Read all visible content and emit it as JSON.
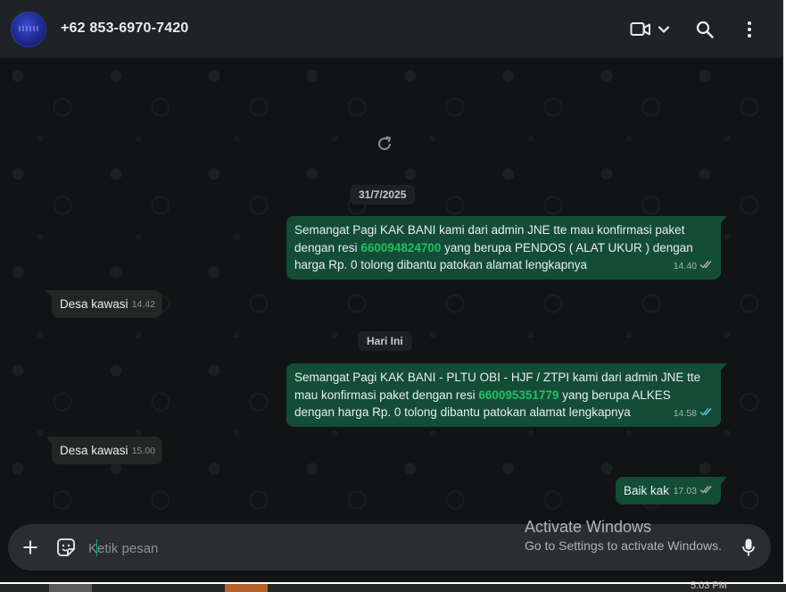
{
  "header": {
    "contact_name": "+62 853-6970-7420",
    "icons": [
      "video-call-icon",
      "chevron-down-icon",
      "search-icon",
      "menu-dots-icon"
    ]
  },
  "chat": {
    "date_chips": [
      "31/7/2025",
      "Hari Ini"
    ],
    "messages": [
      {
        "direction": "outgoing",
        "line1": "Semangat Pagi KAK BANI kami dari admin JNE tte mau konfirmasi paket",
        "line2_before": "dengan resi ",
        "resi": "660094824700",
        "line2_after": " yang berupa PENDOS ( ALAT UKUR ) dengan",
        "line3": "harga Rp. 0 tolong dibantu patokan alamat lengkapnya",
        "time": "14.40",
        "status": "delivered"
      },
      {
        "direction": "incoming",
        "text": "Desa kawasi",
        "time": "14.42"
      },
      {
        "direction": "outgoing",
        "line1": "Semangat Pagi KAK BANI - PLTU OBI - HJF / ZTPI kami dari admin JNE tte",
        "line2_before": "mau konfirmasi paket dengan resi ",
        "resi": "660095351779",
        "line2_after": " yang berupa ALKES",
        "line3": "dengan harga Rp. 0 tolong dibantu patokan alamat lengkapnya",
        "time": "14.58",
        "status": "read"
      },
      {
        "direction": "incoming",
        "text": "Desa kawasi",
        "time": "15.00"
      },
      {
        "direction": "outgoing",
        "text": "Baik kak",
        "time": "17.03",
        "status": "delivered"
      }
    ]
  },
  "composer": {
    "placeholder": "Ketik pesan"
  },
  "watermark": {
    "title": "Activate Windows",
    "subtitle": "Go to Settings to activate Windows."
  },
  "colors": {
    "outgoing_bubble": "#144d37",
    "incoming_bubble": "#242626",
    "resi_link": "#21c063",
    "read_ticks": "#53bdeb",
    "delivered_ticks": "#a6b5ad"
  },
  "taskbar": {
    "clock": "5.03 PM"
  }
}
